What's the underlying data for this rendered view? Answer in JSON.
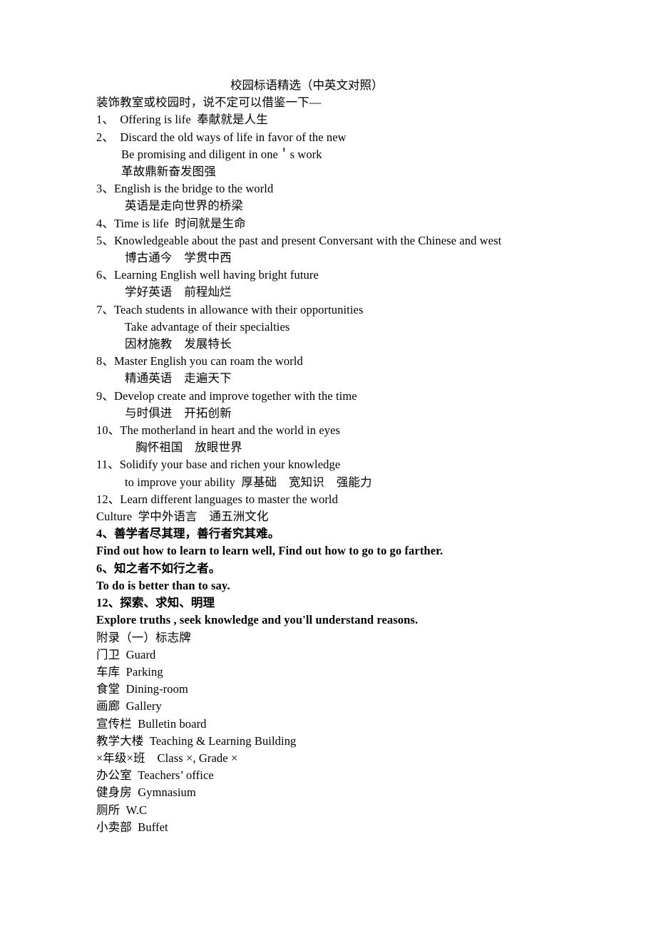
{
  "document": {
    "title": "校园标语精选（中英文对照）",
    "intro": "装饰教室或校园时，说不定可以借鉴一下—",
    "slogans": [
      {
        "num": "1、",
        "en": "  Offering is life  奉献就是人生"
      },
      {
        "num": "2、",
        "en": "  Discard the old ways of life in favor of the new"
      },
      {
        "sub": "Be promising and diligent in one＇s work"
      },
      {
        "sub_cn": "革故鼎新奋发图强"
      },
      {
        "num": "3、",
        "en": "English is the bridge to the world"
      },
      {
        "sub_cn2": "英语是走向世界的桥梁"
      },
      {
        "num": "4、",
        "en": "Time is life  时间就是生命"
      },
      {
        "num": "5、",
        "en": "Knowledgeable about the past and present Conversant with the Chinese and west"
      },
      {
        "sub_cn3": "博古通今    学贯中西"
      },
      {
        "num": "6、",
        "en": "Learning English well having bright future"
      },
      {
        "sub_cn4": "学好英语    前程灿烂"
      },
      {
        "num": "7、",
        "en": "Teach students in allowance with their opportunities"
      },
      {
        "sub2": "Take advantage of their specialties"
      },
      {
        "sub_cn5": "因材施教    发展特长"
      },
      {
        "num": "8、",
        "en": "Master English you can roam the world"
      },
      {
        "sub_cn6": "精通英语    走遍天下"
      },
      {
        "num": "9、",
        "en": "Develop create and improve together with the time"
      },
      {
        "sub_cn7": "与时俱进    开拓创新"
      },
      {
        "num": "10、",
        "en": "The motherland in heart and the world in eyes"
      },
      {
        "sub_cn8": "胸怀祖国    放眼世界"
      },
      {
        "num": "11、",
        "en": "Solidify your base and richen your knowledge"
      },
      {
        "sub3": "to improve your ability  厚基础    宽知识    强能力"
      },
      {
        "num": "12、",
        "en": "Learn different languages to master the world"
      },
      {
        "tail": "Culture  学中外语言    通五洲文化"
      }
    ],
    "lines": {
      "l01": "装饰教室或校园时，说不定可以借鉴一下—",
      "l02": "1、  Offering is life  奉献就是人生",
      "l03": "2、  Discard the old ways of life in favor of the new",
      "l04": "Be promising and diligent in one＇s work",
      "l05": "革故鼎新奋发图强",
      "l06": "3、English is the bridge to the world",
      "l07": "英语是走向世界的桥梁",
      "l08": "4、Time is life  时间就是生命",
      "l09": "5、Knowledgeable about the past and present Conversant with the Chinese and west",
      "l10": "博古通今    学贯中西",
      "l11": "6、Learning English well having bright future",
      "l12": "学好英语    前程灿烂",
      "l13": "7、Teach students in allowance with their opportunities",
      "l14": "Take advantage of their specialties",
      "l15": "因材施教    发展特长",
      "l16": "8、Master English you can roam the world",
      "l17": "精通英语    走遍天下",
      "l18": "9、Develop create and improve together with the time",
      "l19": "与时俱进    开拓创新",
      "l20": "10、The motherland in heart and the world in eyes",
      "l21": "胸怀祖国    放眼世界",
      "l22": "11、Solidify your base and richen your knowledge",
      "l23": "to improve your ability  厚基础    宽知识    强能力",
      "l24": "12、Learn different languages to master the world",
      "l25": "Culture  学中外语言    通五洲文化"
    },
    "proverbs": {
      "p1_cn": "4、善学者尽其理，善行者究其难。",
      "p1_en": "Find out how to learn to learn well, Find out how to go to go farther.",
      "p2_cn": "6、知之者不如行之者。",
      "p2_en": "To do is better than to say.",
      "p3_cn": "12、探索、求知、明理",
      "p3_en": "Explore truths , seek knowledge and you'll understand reasons."
    },
    "appendix": {
      "heading": "附录（一）标志牌",
      "signs": [
        "门卫  Guard",
        "车库  Parking",
        "食堂  Dining-room",
        "画廊  Gallery",
        "宣传栏  Bulletin board",
        "教学大楼  Teaching & Learning Building",
        "×年级×班    Class ×, Grade ×",
        "办公室  Teachers’ office",
        "健身房  Gymnasium",
        "厕所  W.C",
        "小卖部  Buffet"
      ]
    }
  }
}
